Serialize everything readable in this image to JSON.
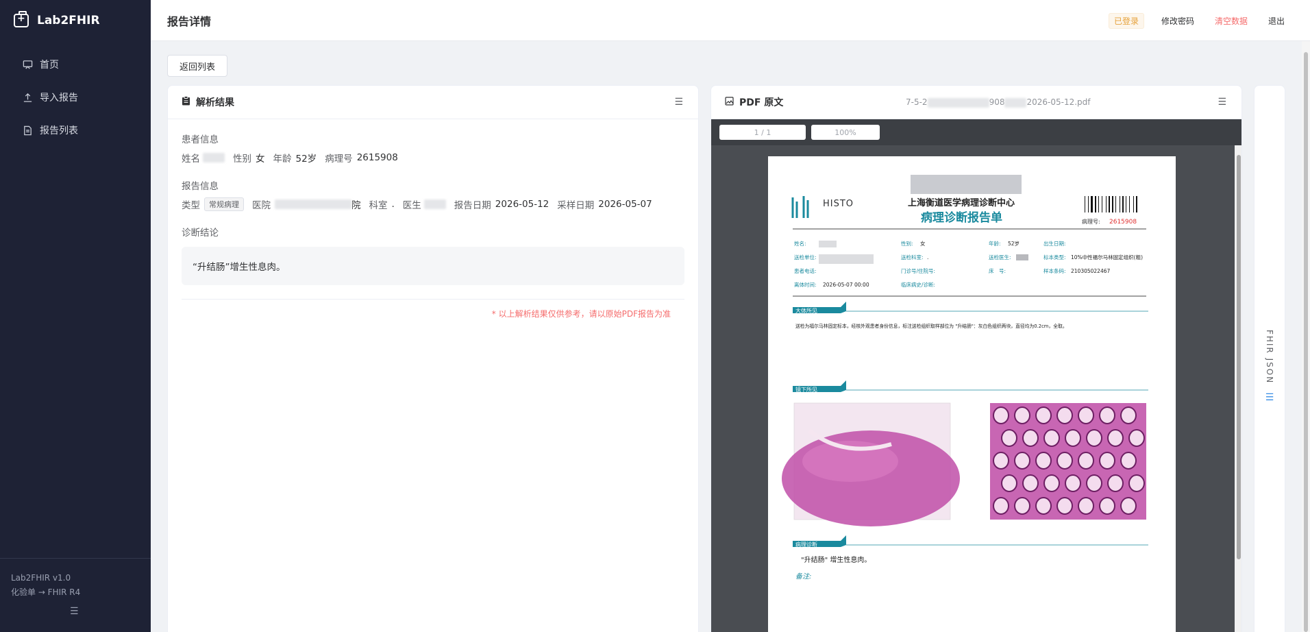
{
  "app": {
    "name": "Lab2FHIR",
    "version": "Lab2FHIR v1.0",
    "tagline": "化验单 → FHIR R4"
  },
  "sidebar": {
    "items": [
      {
        "label": "首页",
        "icon": "home-icon"
      },
      {
        "label": "导入报告",
        "icon": "upload-icon"
      },
      {
        "label": "报告列表",
        "icon": "document-icon"
      }
    ]
  },
  "header": {
    "title": "报告详情",
    "status": "已登录",
    "change_password": "修改密码",
    "clear_data": "清空数据",
    "logout": "退出"
  },
  "back_label": "返回列表",
  "parse": {
    "title": "解析结果",
    "patient_section": "患者信息",
    "name_label": "姓名",
    "gender_label": "性别",
    "gender": "女",
    "age_label": "年龄",
    "age": "52岁",
    "pathology_no_label": "病理号",
    "pathology_no": "2615908",
    "report_section": "报告信息",
    "type_label": "类型",
    "type_tag": "常规病理",
    "hospital_label": "医院",
    "hospital_tail": "院",
    "dept_label": "科室",
    "dept": ".",
    "doctor_label": "医生",
    "report_date_label": "报告日期",
    "report_date": "2026-05-12",
    "sample_date_label": "采样日期",
    "sample_date": "2026-05-07",
    "diagnosis_section": "诊断结论",
    "diagnosis": "“升结肠”增生性息肉。",
    "disclaimer": "* 以上解析结果仅供参考，请以原始PDF报告为准"
  },
  "pdf": {
    "title": "PDF 原文",
    "filename_prefix": "7-5-2",
    "filename_mid": "908",
    "filename_suffix": "2026-05-12.pdf",
    "page_indicator": "1 / 1",
    "zoom": "100%",
    "doc": {
      "logo_text": "HISTO",
      "center_name": "上海衡道医学病理诊断中心",
      "report_title": "病理诊断报告单",
      "pathology_no_label": "病理号:",
      "pathology_no": "2615908",
      "fields": {
        "name": "姓名:",
        "gender": "性别:",
        "gender_val": "女",
        "age": "年龄:",
        "age_val": "52岁",
        "birth": "出生日期:",
        "unit": "送检单位:",
        "dept": "送检科室:",
        "dept_val": ".",
        "doctor": "送检医生:",
        "specimen_type": "标本类型:",
        "specimen_type_val": "10%中性福尔马林固定组织(粗)",
        "phone": "患者电话:",
        "clinic": "门诊号/住院号:",
        "bed": "床　号:",
        "barcode": "样本条码:",
        "barcode_val": "210305022467",
        "sample_time": "离体时间:",
        "sample_time_val": "2026-05-07 00:00",
        "clinical": "临床病史/诊断:"
      },
      "gross_title": "大体所见",
      "gross_text": "送检为福尔马林固定标本，经核外观患者身份信息，标注送检组织取样部位为 \"升结肠\"：灰白色组织两块，直径均为0.2cm，全取。",
      "micro_title": "镜下所见",
      "dx_title": "病理诊断",
      "dx_text": "\"升结肠\" 增生性息肉。",
      "remark": "备注:"
    }
  },
  "fhir_panel": {
    "label": "FHIR JSON"
  },
  "colors": {
    "sidebar_bg": "#1e2235",
    "accent_teal": "#1a8a9e",
    "danger": "#f56c6c",
    "warning": "#e6a23c",
    "link": "#3a8ee6"
  }
}
